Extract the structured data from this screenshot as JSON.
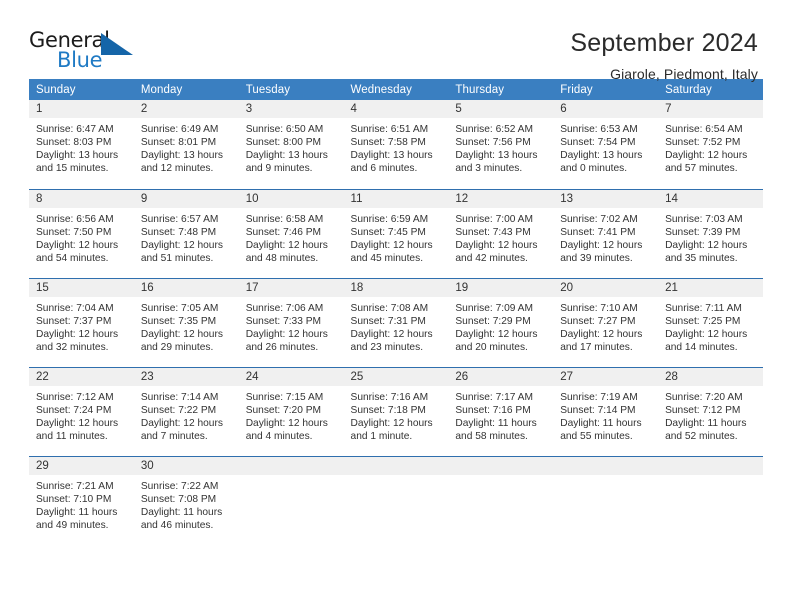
{
  "brand": {
    "name_top": "General",
    "name_bottom": "Blue",
    "triangle_color": "#1565a8",
    "blue_color": "#1f7ac4"
  },
  "header": {
    "title": "September 2024",
    "subtitle": "Giarole, Piedmont, Italy"
  },
  "theme": {
    "header_bg": "#3a7fc1",
    "week_divider": "#2f6fae",
    "daynum_bg": "#f0f0f0",
    "text": "#333333"
  },
  "weekday_headers": [
    "Sunday",
    "Monday",
    "Tuesday",
    "Wednesday",
    "Thursday",
    "Friday",
    "Saturday"
  ],
  "weeks": [
    {
      "days": [
        {
          "num": "1",
          "sunrise": "Sunrise: 6:47 AM",
          "sunset": "Sunset: 8:03 PM",
          "daylight_line1": "Daylight: 13 hours",
          "daylight_line2": "and 15 minutes."
        },
        {
          "num": "2",
          "sunrise": "Sunrise: 6:49 AM",
          "sunset": "Sunset: 8:01 PM",
          "daylight_line1": "Daylight: 13 hours",
          "daylight_line2": "and 12 minutes."
        },
        {
          "num": "3",
          "sunrise": "Sunrise: 6:50 AM",
          "sunset": "Sunset: 8:00 PM",
          "daylight_line1": "Daylight: 13 hours",
          "daylight_line2": "and 9 minutes."
        },
        {
          "num": "4",
          "sunrise": "Sunrise: 6:51 AM",
          "sunset": "Sunset: 7:58 PM",
          "daylight_line1": "Daylight: 13 hours",
          "daylight_line2": "and 6 minutes."
        },
        {
          "num": "5",
          "sunrise": "Sunrise: 6:52 AM",
          "sunset": "Sunset: 7:56 PM",
          "daylight_line1": "Daylight: 13 hours",
          "daylight_line2": "and 3 minutes."
        },
        {
          "num": "6",
          "sunrise": "Sunrise: 6:53 AM",
          "sunset": "Sunset: 7:54 PM",
          "daylight_line1": "Daylight: 13 hours",
          "daylight_line2": "and 0 minutes."
        },
        {
          "num": "7",
          "sunrise": "Sunrise: 6:54 AM",
          "sunset": "Sunset: 7:52 PM",
          "daylight_line1": "Daylight: 12 hours",
          "daylight_line2": "and 57 minutes."
        }
      ]
    },
    {
      "days": [
        {
          "num": "8",
          "sunrise": "Sunrise: 6:56 AM",
          "sunset": "Sunset: 7:50 PM",
          "daylight_line1": "Daylight: 12 hours",
          "daylight_line2": "and 54 minutes."
        },
        {
          "num": "9",
          "sunrise": "Sunrise: 6:57 AM",
          "sunset": "Sunset: 7:48 PM",
          "daylight_line1": "Daylight: 12 hours",
          "daylight_line2": "and 51 minutes."
        },
        {
          "num": "10",
          "sunrise": "Sunrise: 6:58 AM",
          "sunset": "Sunset: 7:46 PM",
          "daylight_line1": "Daylight: 12 hours",
          "daylight_line2": "and 48 minutes."
        },
        {
          "num": "11",
          "sunrise": "Sunrise: 6:59 AM",
          "sunset": "Sunset: 7:45 PM",
          "daylight_line1": "Daylight: 12 hours",
          "daylight_line2": "and 45 minutes."
        },
        {
          "num": "12",
          "sunrise": "Sunrise: 7:00 AM",
          "sunset": "Sunset: 7:43 PM",
          "daylight_line1": "Daylight: 12 hours",
          "daylight_line2": "and 42 minutes."
        },
        {
          "num": "13",
          "sunrise": "Sunrise: 7:02 AM",
          "sunset": "Sunset: 7:41 PM",
          "daylight_line1": "Daylight: 12 hours",
          "daylight_line2": "and 39 minutes."
        },
        {
          "num": "14",
          "sunrise": "Sunrise: 7:03 AM",
          "sunset": "Sunset: 7:39 PM",
          "daylight_line1": "Daylight: 12 hours",
          "daylight_line2": "and 35 minutes."
        }
      ]
    },
    {
      "days": [
        {
          "num": "15",
          "sunrise": "Sunrise: 7:04 AM",
          "sunset": "Sunset: 7:37 PM",
          "daylight_line1": "Daylight: 12 hours",
          "daylight_line2": "and 32 minutes."
        },
        {
          "num": "16",
          "sunrise": "Sunrise: 7:05 AM",
          "sunset": "Sunset: 7:35 PM",
          "daylight_line1": "Daylight: 12 hours",
          "daylight_line2": "and 29 minutes."
        },
        {
          "num": "17",
          "sunrise": "Sunrise: 7:06 AM",
          "sunset": "Sunset: 7:33 PM",
          "daylight_line1": "Daylight: 12 hours",
          "daylight_line2": "and 26 minutes."
        },
        {
          "num": "18",
          "sunrise": "Sunrise: 7:08 AM",
          "sunset": "Sunset: 7:31 PM",
          "daylight_line1": "Daylight: 12 hours",
          "daylight_line2": "and 23 minutes."
        },
        {
          "num": "19",
          "sunrise": "Sunrise: 7:09 AM",
          "sunset": "Sunset: 7:29 PM",
          "daylight_line1": "Daylight: 12 hours",
          "daylight_line2": "and 20 minutes."
        },
        {
          "num": "20",
          "sunrise": "Sunrise: 7:10 AM",
          "sunset": "Sunset: 7:27 PM",
          "daylight_line1": "Daylight: 12 hours",
          "daylight_line2": "and 17 minutes."
        },
        {
          "num": "21",
          "sunrise": "Sunrise: 7:11 AM",
          "sunset": "Sunset: 7:25 PM",
          "daylight_line1": "Daylight: 12 hours",
          "daylight_line2": "and 14 minutes."
        }
      ]
    },
    {
      "days": [
        {
          "num": "22",
          "sunrise": "Sunrise: 7:12 AM",
          "sunset": "Sunset: 7:24 PM",
          "daylight_line1": "Daylight: 12 hours",
          "daylight_line2": "and 11 minutes."
        },
        {
          "num": "23",
          "sunrise": "Sunrise: 7:14 AM",
          "sunset": "Sunset: 7:22 PM",
          "daylight_line1": "Daylight: 12 hours",
          "daylight_line2": "and 7 minutes."
        },
        {
          "num": "24",
          "sunrise": "Sunrise: 7:15 AM",
          "sunset": "Sunset: 7:20 PM",
          "daylight_line1": "Daylight: 12 hours",
          "daylight_line2": "and 4 minutes."
        },
        {
          "num": "25",
          "sunrise": "Sunrise: 7:16 AM",
          "sunset": "Sunset: 7:18 PM",
          "daylight_line1": "Daylight: 12 hours",
          "daylight_line2": "and 1 minute."
        },
        {
          "num": "26",
          "sunrise": "Sunrise: 7:17 AM",
          "sunset": "Sunset: 7:16 PM",
          "daylight_line1": "Daylight: 11 hours",
          "daylight_line2": "and 58 minutes."
        },
        {
          "num": "27",
          "sunrise": "Sunrise: 7:19 AM",
          "sunset": "Sunset: 7:14 PM",
          "daylight_line1": "Daylight: 11 hours",
          "daylight_line2": "and 55 minutes."
        },
        {
          "num": "28",
          "sunrise": "Sunrise: 7:20 AM",
          "sunset": "Sunset: 7:12 PM",
          "daylight_line1": "Daylight: 11 hours",
          "daylight_line2": "and 52 minutes."
        }
      ]
    },
    {
      "days": [
        {
          "num": "29",
          "sunrise": "Sunrise: 7:21 AM",
          "sunset": "Sunset: 7:10 PM",
          "daylight_line1": "Daylight: 11 hours",
          "daylight_line2": "and 49 minutes."
        },
        {
          "num": "30",
          "sunrise": "Sunrise: 7:22 AM",
          "sunset": "Sunset: 7:08 PM",
          "daylight_line1": "Daylight: 11 hours",
          "daylight_line2": "and 46 minutes."
        },
        {
          "num": "",
          "sunrise": "",
          "sunset": "",
          "daylight_line1": "",
          "daylight_line2": ""
        },
        {
          "num": "",
          "sunrise": "",
          "sunset": "",
          "daylight_line1": "",
          "daylight_line2": ""
        },
        {
          "num": "",
          "sunrise": "",
          "sunset": "",
          "daylight_line1": "",
          "daylight_line2": ""
        },
        {
          "num": "",
          "sunrise": "",
          "sunset": "",
          "daylight_line1": "",
          "daylight_line2": ""
        },
        {
          "num": "",
          "sunrise": "",
          "sunset": "",
          "daylight_line1": "",
          "daylight_line2": ""
        }
      ]
    }
  ]
}
